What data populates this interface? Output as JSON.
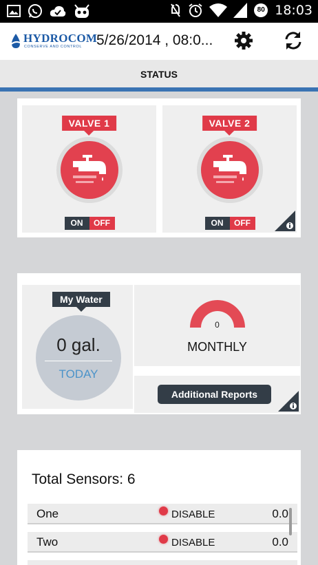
{
  "statusbar": {
    "time": "18:03",
    "battery": "80"
  },
  "header": {
    "brand": "HYDROCOM",
    "tagline": "CONSERVE AND CONTROL",
    "title": "5/26/2014 , 08:0..."
  },
  "tabs": [
    {
      "label": "STATUS",
      "active": true
    }
  ],
  "valves": [
    {
      "label": "VALVE 1",
      "on_label": "ON",
      "off_label": "OFF",
      "state": "off"
    },
    {
      "label": "VALVE 2",
      "on_label": "ON",
      "off_label": "OFF",
      "state": "off"
    }
  ],
  "water": {
    "title": "My Water",
    "amount": "0 gal.",
    "period": "TODAY",
    "gauge_value": "0",
    "gauge_label": "MONTHLY",
    "reports_label": "Additional Reports"
  },
  "sensors": {
    "title": "Total Sensors: 6",
    "rows": [
      {
        "name": "One",
        "status": "DISABLE",
        "value": "0.0"
      },
      {
        "name": "Two",
        "status": "DISABLE",
        "value": "0.0"
      }
    ]
  },
  "colors": {
    "accent_red": "#e03a48",
    "dark": "#333d47",
    "brand_blue": "#1c5aa6",
    "tab_indicator": "#3a73b3",
    "today_blue": "#4b93c9"
  }
}
